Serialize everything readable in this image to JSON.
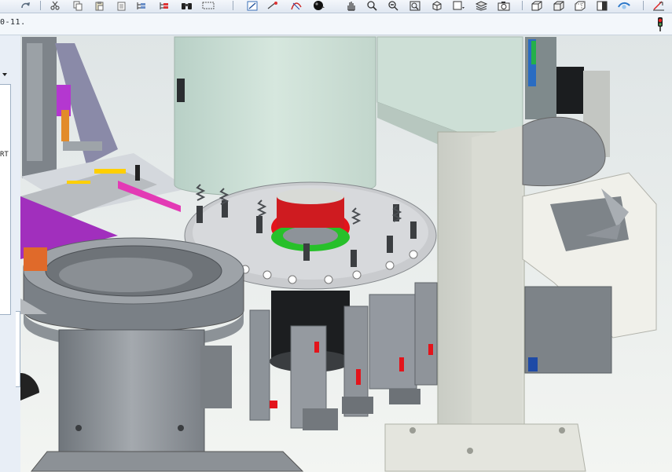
{
  "app": {
    "document_path_text": "0-11.",
    "left_panel_text": "RT"
  },
  "toolbar": {
    "buttons": [
      {
        "id": "redo",
        "icon": "redo-icon"
      },
      {
        "id": "cut",
        "icon": "scissors-icon"
      },
      {
        "id": "copy",
        "icon": "copy-icon"
      },
      {
        "id": "paste",
        "icon": "paste-icon"
      },
      {
        "id": "paste-special",
        "icon": "paste-special-icon"
      },
      {
        "id": "tree",
        "icon": "tree-icon"
      },
      {
        "id": "tree-red",
        "icon": "tree-red-icon"
      },
      {
        "id": "binoculars",
        "icon": "binoculars-icon"
      },
      {
        "id": "select",
        "icon": "select-box-icon"
      },
      {
        "id": "sketch",
        "icon": "sketch-icon"
      },
      {
        "id": "line",
        "icon": "line-icon"
      },
      {
        "id": "curve",
        "icon": "curve-icon"
      },
      {
        "id": "sphere",
        "icon": "sphere-icon"
      },
      {
        "id": "pan",
        "icon": "hand-icon"
      },
      {
        "id": "zoom",
        "icon": "zoom-icon"
      },
      {
        "id": "zoom-out",
        "icon": "zoom-out-icon"
      },
      {
        "id": "zoom-fit",
        "icon": "zoom-fit-icon"
      },
      {
        "id": "view-orient",
        "icon": "view-orientation-icon"
      },
      {
        "id": "view-menu",
        "icon": "view-menu-icon"
      },
      {
        "id": "layers",
        "icon": "layers-icon"
      },
      {
        "id": "camera",
        "icon": "camera-icon"
      },
      {
        "id": "shaded",
        "icon": "shaded-icon"
      },
      {
        "id": "wireframe",
        "icon": "wireframe-icon"
      },
      {
        "id": "hidden",
        "icon": "hidden-line-icon"
      },
      {
        "id": "display",
        "icon": "display-icon"
      },
      {
        "id": "appearance",
        "icon": "appearance-icon"
      },
      {
        "id": "measure",
        "icon": "measure-icon"
      }
    ],
    "status_icon": "traffic-light-icon"
  },
  "colors": {
    "toolbar_bg": "#e6edf5",
    "path_bar_bg": "#f3f7fb",
    "viewport_bg": "#e9eef2",
    "machine_gray": "#8d9399",
    "mint_housing": "#c9ddd2",
    "accent_red": "#e3141b",
    "accent_green": "#27c02a",
    "accent_purple": "#b437d0"
  }
}
